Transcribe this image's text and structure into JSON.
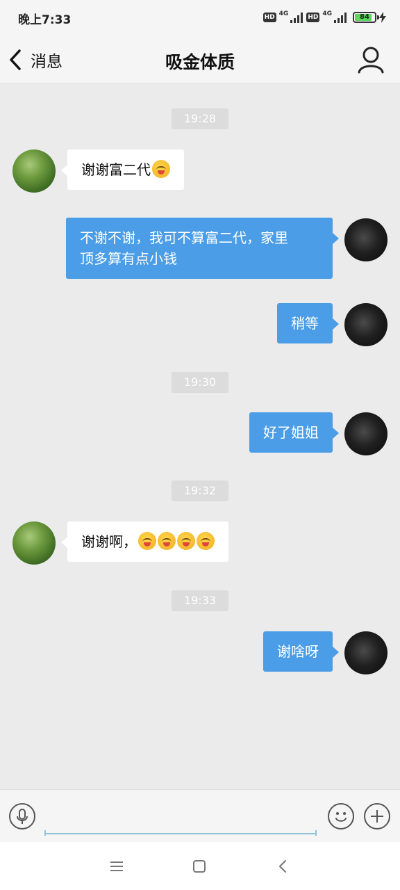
{
  "status_bar": {
    "time": "晚上7:33",
    "hd_label": "HD",
    "network_label": "4G",
    "battery_level": "84",
    "battery_percent": 84
  },
  "header": {
    "back_label": "消息",
    "title": "吸金体质"
  },
  "messages": [
    {
      "type": "time",
      "text": "19:28"
    },
    {
      "type": "incoming",
      "text": "谢谢富二代",
      "emoji_count": 1
    },
    {
      "type": "outgoing",
      "lines": [
        "不谢不谢，我可不算富二代，家里",
        "顶多算有点小钱"
      ]
    },
    {
      "type": "outgoing",
      "text": "稍等"
    },
    {
      "type": "time",
      "text": "19:30"
    },
    {
      "type": "outgoing",
      "text": "好了姐姐"
    },
    {
      "type": "time",
      "text": "19:32"
    },
    {
      "type": "incoming",
      "text": "谢谢啊，",
      "emoji_count": 4
    },
    {
      "type": "time",
      "text": "19:33"
    },
    {
      "type": "outgoing",
      "text": "谢啥呀"
    }
  ],
  "input": {
    "value": "",
    "placeholder": ""
  },
  "icons": {
    "back": "chevron-left-icon",
    "profile": "person-icon",
    "mic": "microphone-icon",
    "emoji": "smiley-icon",
    "plus": "plus-icon",
    "menu": "menu-icon",
    "home": "home-square-icon",
    "nav_back": "nav-back-icon"
  },
  "colors": {
    "outgoing_bubble": "#4a9de6",
    "incoming_bubble": "#ffffff",
    "chat_background": "#ebebeb",
    "time_chip": "#dcdcdc",
    "input_underline": "#8ec5d8",
    "battery_fill": "#5cd65c"
  }
}
